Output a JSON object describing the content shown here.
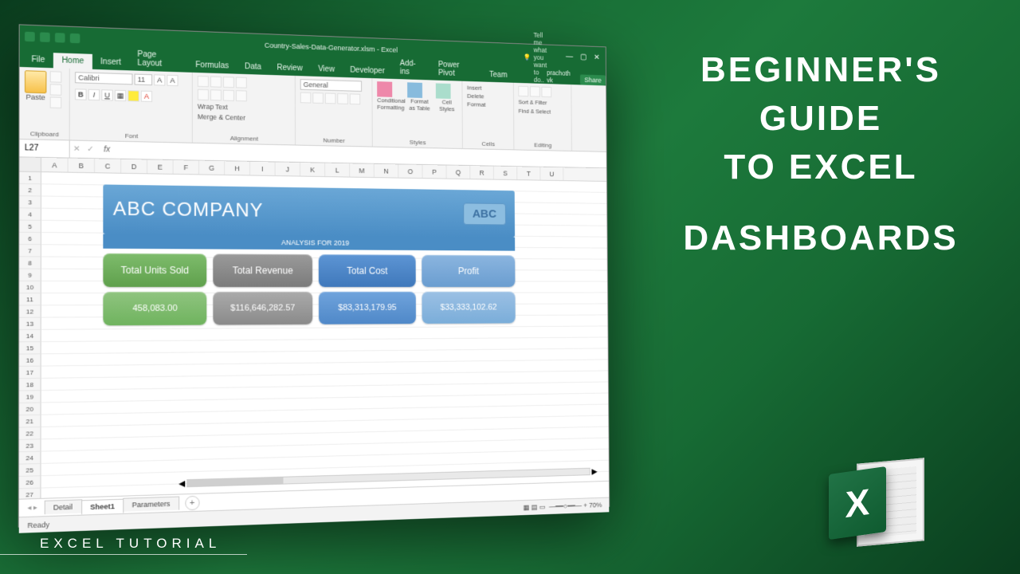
{
  "window": {
    "title": "Country-Sales-Data-Generator.xlsm - Excel",
    "user": "prachoth vk",
    "share": "Share"
  },
  "ribbon": {
    "tabs": [
      "File",
      "Home",
      "Insert",
      "Page Layout",
      "Formulas",
      "Data",
      "Review",
      "View",
      "Developer",
      "Add-ins",
      "Power Pivot",
      "Team"
    ],
    "active_tab": "Home",
    "tellme": "Tell me what you want to do..",
    "clipboard": {
      "paste": "Paste",
      "label": "Clipboard"
    },
    "font": {
      "name": "Calibri",
      "size": "11",
      "label": "Font"
    },
    "alignment": {
      "wrap": "Wrap Text",
      "merge": "Merge & Center",
      "label": "Alignment"
    },
    "number": {
      "format": "General",
      "label": "Number"
    },
    "styles": {
      "cond": "Conditional Formatting",
      "fmt": "Format as Table",
      "cell": "Cell Styles",
      "label": "Styles"
    },
    "cells": {
      "insert": "Insert",
      "delete": "Delete",
      "format": "Format",
      "label": "Cells"
    },
    "editing": {
      "sort": "Sort & Filter",
      "find": "Find & Select",
      "label": "Editing"
    }
  },
  "namebox": "L27",
  "fx": "fx",
  "columns": [
    "A",
    "B",
    "C",
    "D",
    "E",
    "F",
    "G",
    "H",
    "I",
    "J",
    "K",
    "L",
    "M",
    "N",
    "O",
    "P",
    "Q",
    "R",
    "S",
    "T",
    "U"
  ],
  "dashboard": {
    "company": "ABC COMPANY",
    "logo": "ABC",
    "subtitle": "ANALYSIS FOR 2019",
    "kpis": [
      {
        "label": "Total Units Sold",
        "value": "458,083.00"
      },
      {
        "label": "Total Revenue",
        "value": "$116,646,282.57"
      },
      {
        "label": "Total Cost",
        "value": "$83,313,179.95"
      },
      {
        "label": "Profit",
        "value": "$33,333,102.62"
      }
    ]
  },
  "sheets": {
    "tabs": [
      "Detail",
      "Sheet1",
      "Parameters"
    ],
    "active": "Sheet1"
  },
  "status": {
    "ready": "Ready",
    "zoom": "70%"
  },
  "promo": {
    "line1": "BEGINNER'S",
    "line2": "GUIDE",
    "line3": "TO EXCEL",
    "line4": "DASHBOARDS",
    "footer": "EXCEL TUTORIAL",
    "logo": "X"
  }
}
